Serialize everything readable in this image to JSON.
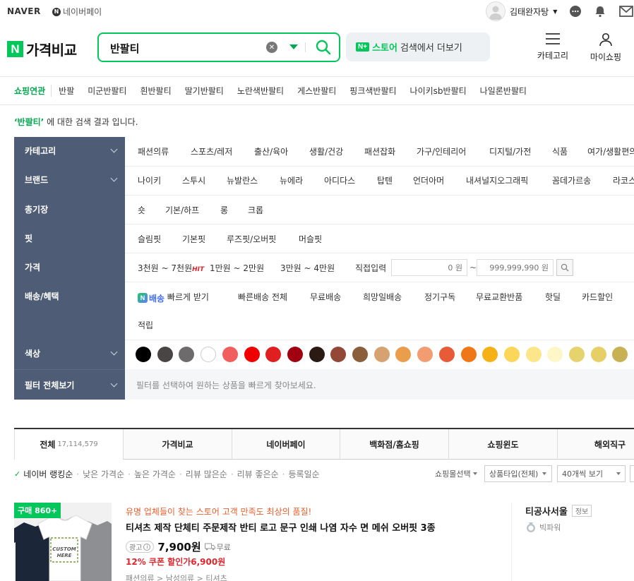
{
  "topbar": {
    "naver": "NAVER",
    "npay": "네이버페이",
    "npay_icon": "N",
    "user_name": "김태완자탕"
  },
  "header": {
    "brand_n": "N",
    "brand": "가격비교",
    "search_value": "반팔티",
    "store_n": "N+",
    "store_word": "스토어",
    "store_rest": "검색에서 더보기",
    "category": "카테고리",
    "myshopping": "마이쇼핑"
  },
  "related": {
    "label": "쇼핑연관",
    "keywords": [
      "반팔",
      "미군반팔티",
      "흰반팔티",
      "딸기반팔티",
      "노란색반팔티",
      "게스반팔티",
      "핑크색반팔티",
      "나이키sb반팔티",
      "나일론반팔티"
    ]
  },
  "result_msg": {
    "query": "‘반팔티’",
    "rest": " 에 대한 검색 결과 입니다."
  },
  "filters": {
    "labels": [
      "카테고리",
      "브랜드",
      "총기장",
      "핏",
      "가격",
      "배송/혜택",
      "색상",
      "필터 전체보기"
    ],
    "category": [
      "패션의류",
      "스포츠/레저",
      "출산/육아",
      "생활/건강",
      "패션잡화",
      "가구/인테리어",
      "디지털/가전",
      "식품",
      "여가/생활편의"
    ],
    "brand": [
      "나이키",
      "스투시",
      "뉴발란스",
      "뉴에라",
      "아디다스",
      "탑텐",
      "언더아머",
      "내셔널지오그래픽",
      "꼼데가르송",
      "라코스테"
    ],
    "length": [
      "숏",
      "기본/하프",
      "롱",
      "크롭"
    ],
    "fit": [
      "슬림핏",
      "기본핏",
      "루즈핏/오버핏",
      "머슬핏"
    ],
    "price": {
      "opt1": "3천원 ~ 7천원",
      "hit": "HIT",
      "opt2": "1만원 ~ 2만원",
      "opt3": "3만원 ~ 4만원",
      "direct": "직접입력",
      "min_placeholder": "0 원",
      "tilde": "~",
      "max_placeholder": "999,999,990 원"
    },
    "shipping": {
      "badge_m": "N",
      "badge_text": "배송",
      "fast": "빠르게 받기",
      "items": [
        "빠른배송 전체",
        "무료배송",
        "희망일배송",
        "정기구독",
        "무료교환반품",
        "핫딜",
        "카드할인"
      ],
      "extra": "적립"
    },
    "colors": [
      "#000000",
      "#4a4545",
      "#6d6b6b",
      "#ffffff",
      "#f25e5e",
      "#f00000",
      "#e02020",
      "#a00010",
      "#2a1a14",
      "#924737",
      "#8b5e3c",
      "#d7a271",
      "#ea9d4b",
      "#f29c71",
      "#e85b39",
      "#f07718",
      "#f6b116",
      "#fbd659",
      "#fde68a",
      "#fdf6c6",
      "#e6d36e",
      "#e5cf66",
      "#c7b152"
    ],
    "all_hint": "필터를 선택하여 원하는 상품을 빠르게 찾아보세요."
  },
  "tabs": [
    {
      "label": "전체",
      "count": "17,114,579"
    },
    {
      "label": "가격비교",
      "count": ""
    },
    {
      "label": "네이버페이",
      "count": ""
    },
    {
      "label": "백화점/홈쇼핑",
      "count": ""
    },
    {
      "label": "쇼핑윈도",
      "count": ""
    },
    {
      "label": "해외직구",
      "count": ""
    }
  ],
  "sort": {
    "items": [
      "네이버 랭킹순",
      "낮은 가격순",
      "높은 가격순",
      "리뷰 많은순",
      "리뷰 좋은순",
      "등록일순"
    ],
    "mall_select": "쇼핑몰선택",
    "type_select": "상품타입(전체)",
    "per_page": "40개씩 보기"
  },
  "product": {
    "buy_badge": "구매 860+",
    "thumb_text": "CUSTOM HERE",
    "promo": "유명 업체들이 찾는 스토어 고객 만족도 최상의 품질!",
    "title": "티셔츠 제작 단체티 주문제작 반티 로고 문구 인쇄 나염 자수 면 메쉬 오버핏 3종",
    "ad": "광고",
    "ad_info": "i",
    "price": "7,900원",
    "shipping": "무료",
    "coupon": "12% 쿠폰 할인가6,900원",
    "category_path": "패션의류 > 남성의류 > 티셔츠",
    "seller": "티공사서울",
    "seller_info": "정보",
    "power": "빅파워"
  }
}
